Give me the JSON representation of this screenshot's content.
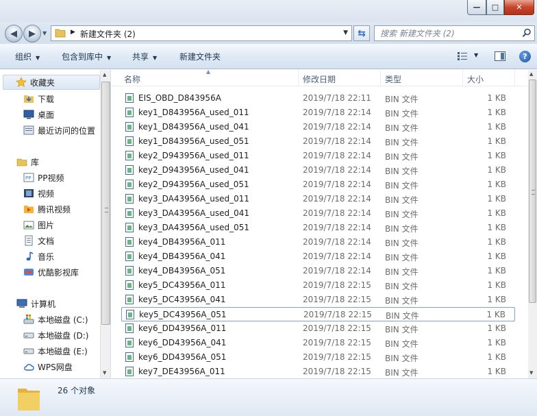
{
  "window": {
    "title_buttons": {
      "minimize": "—",
      "maximize": "□",
      "close": "✕"
    }
  },
  "address": {
    "path": "新建文件夹 (2)",
    "search_placeholder": "搜索 新建文件夹 (2)"
  },
  "toolbar": {
    "organize": "组织",
    "include_in_library": "包含到库中",
    "share": "共享",
    "new_folder": "新建文件夹"
  },
  "nav": {
    "favorites": "收藏夹",
    "downloads": "下载",
    "desktop": "桌面",
    "recent": "最近访问的位置",
    "libraries": "库",
    "pp_video": "PP视频",
    "videos": "视频",
    "tencent_video": "腾讯视频",
    "pictures": "图片",
    "documents": "文档",
    "music": "音乐",
    "youku": "优酷影视库",
    "computer": "计算机",
    "disk_c": "本地磁盘 (C:)",
    "disk_d": "本地磁盘 (D:)",
    "disk_e": "本地磁盘 (E:)",
    "wps": "WPS网盘"
  },
  "columns": {
    "name": "名称",
    "modified": "修改日期",
    "type": "类型",
    "size": "大小"
  },
  "files": [
    {
      "name": "EIS_OBD_D843956A",
      "date": "2019/7/18 22:11",
      "type": "BIN 文件",
      "size": "1 KB"
    },
    {
      "name": "key1_D843956A_used_011",
      "date": "2019/7/18 22:14",
      "type": "BIN 文件",
      "size": "1 KB"
    },
    {
      "name": "key1_D843956A_used_041",
      "date": "2019/7/18 22:14",
      "type": "BIN 文件",
      "size": "1 KB"
    },
    {
      "name": "key1_D843956A_used_051",
      "date": "2019/7/18 22:14",
      "type": "BIN 文件",
      "size": "1 KB"
    },
    {
      "name": "key2_D943956A_used_011",
      "date": "2019/7/18 22:14",
      "type": "BIN 文件",
      "size": "1 KB"
    },
    {
      "name": "key2_D943956A_used_041",
      "date": "2019/7/18 22:14",
      "type": "BIN 文件",
      "size": "1 KB"
    },
    {
      "name": "key2_D943956A_used_051",
      "date": "2019/7/18 22:14",
      "type": "BIN 文件",
      "size": "1 KB"
    },
    {
      "name": "key3_DA43956A_used_011",
      "date": "2019/7/18 22:14",
      "type": "BIN 文件",
      "size": "1 KB"
    },
    {
      "name": "key3_DA43956A_used_041",
      "date": "2019/7/18 22:14",
      "type": "BIN 文件",
      "size": "1 KB"
    },
    {
      "name": "key3_DA43956A_used_051",
      "date": "2019/7/18 22:14",
      "type": "BIN 文件",
      "size": "1 KB"
    },
    {
      "name": "key4_DB43956A_011",
      "date": "2019/7/18 22:14",
      "type": "BIN 文件",
      "size": "1 KB"
    },
    {
      "name": "key4_DB43956A_041",
      "date": "2019/7/18 22:14",
      "type": "BIN 文件",
      "size": "1 KB"
    },
    {
      "name": "key4_DB43956A_051",
      "date": "2019/7/18 22:14",
      "type": "BIN 文件",
      "size": "1 KB"
    },
    {
      "name": "key5_DC43956A_011",
      "date": "2019/7/18 22:15",
      "type": "BIN 文件",
      "size": "1 KB"
    },
    {
      "name": "key5_DC43956A_041",
      "date": "2019/7/18 22:15",
      "type": "BIN 文件",
      "size": "1 KB"
    },
    {
      "name": "key5_DC43956A_051",
      "date": "2019/7/18 22:15",
      "type": "BIN 文件",
      "size": "1 KB"
    },
    {
      "name": "key6_DD43956A_011",
      "date": "2019/7/18 22:15",
      "type": "BIN 文件",
      "size": "1 KB"
    },
    {
      "name": "key6_DD43956A_041",
      "date": "2019/7/18 22:15",
      "type": "BIN 文件",
      "size": "1 KB"
    },
    {
      "name": "key6_DD43956A_051",
      "date": "2019/7/18 22:15",
      "type": "BIN 文件",
      "size": "1 KB"
    },
    {
      "name": "key7_DE43956A_011",
      "date": "2019/7/18 22:15",
      "type": "BIN 文件",
      "size": "1 KB"
    }
  ],
  "selected_index": 15,
  "status": {
    "count": "26 个对象"
  },
  "colors": {
    "accent": "#2d6ad0",
    "folder": "#f2c94c"
  }
}
